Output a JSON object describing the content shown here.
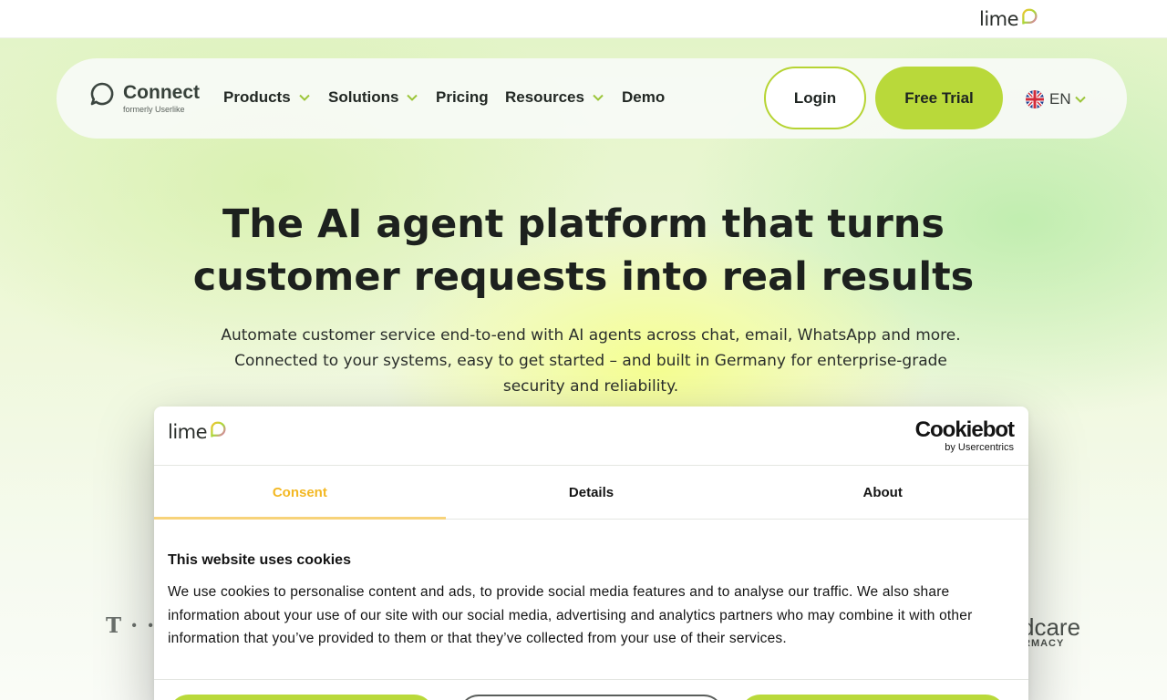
{
  "topbar": {
    "brand_word": "lime",
    "brand_icon": "lime-ring-icon"
  },
  "nav": {
    "brand": {
      "name": "Connect",
      "tagline": "formerly Userlike",
      "icon": "speech-bubble-icon"
    },
    "items": [
      {
        "label": "Products",
        "has_dropdown": true
      },
      {
        "label": "Solutions",
        "has_dropdown": true
      },
      {
        "label": "Pricing",
        "has_dropdown": false
      },
      {
        "label": "Resources",
        "has_dropdown": true
      },
      {
        "label": "Demo",
        "has_dropdown": false
      }
    ],
    "login_label": "Login",
    "trial_label": "Free Trial",
    "language": {
      "code": "EN",
      "flag": "uk-flag-icon"
    }
  },
  "hero": {
    "headline_line1": "The AI agent platform that turns",
    "headline_line2": "customer requests into real results",
    "sub_line1": "Automate customer service end-to-end with AI agents across chat, email, WhatsApp and more.",
    "sub_line2": "Connected to your systems, easy to get started – and built in Germany for enterprise-grade",
    "sub_line3": "security and reliability."
  },
  "logos": {
    "left_partial": "T · · S",
    "right_partial": "dcare",
    "right_partial_sub": "RMACY"
  },
  "cookie_dialog": {
    "brand_word": "lime",
    "provider": {
      "name": "Cookiebot",
      "by": "by Usercentrics"
    },
    "tabs": [
      {
        "label": "Consent",
        "active": true
      },
      {
        "label": "Details",
        "active": false
      },
      {
        "label": "About",
        "active": false
      }
    ],
    "title": "This website uses cookies",
    "body": "We use cookies to personalise content and ads, to provide social media features and to analyse our traffic. We also share information about your use of our site with our social media, advertising and analytics partners who may combine it with other information that you’ve provided to them or that they’ve collected from your use of their services.",
    "buttons": {
      "deny": "",
      "allow_selection": "",
      "allow_all": ""
    }
  },
  "colors": {
    "accent_green": "#b9d93a",
    "consent_tab": "#f3b823",
    "text_dark": "#1d211e"
  }
}
